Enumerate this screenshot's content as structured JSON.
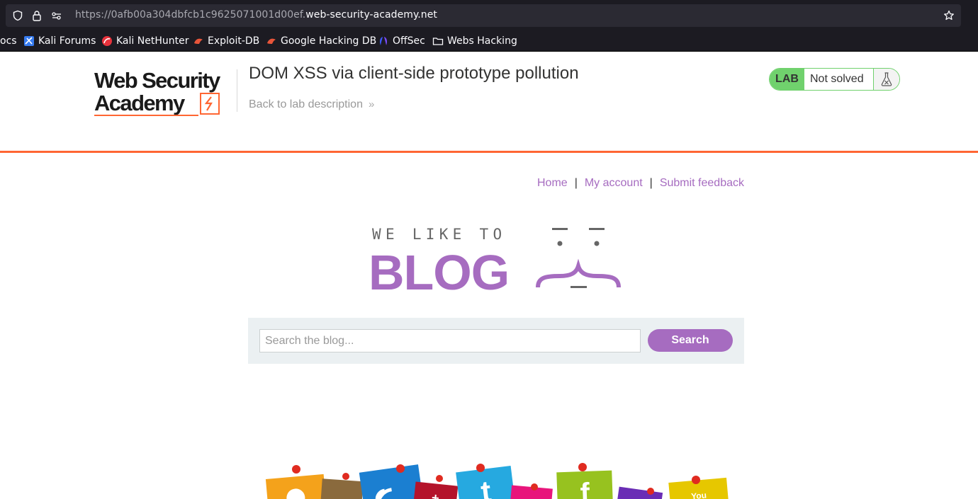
{
  "browser": {
    "url_prefix": "https://0afb00a304dbfcb1c9625071001d00ef.",
    "url_domain": "web-security-academy.net",
    "bookmarks": [
      {
        "label": "ocs",
        "icon": "docs-icon"
      },
      {
        "label": "Kali Forums",
        "icon": "kali-forums-icon"
      },
      {
        "label": "Kali NetHunter",
        "icon": "kali-nethunter-icon"
      },
      {
        "label": "Exploit-DB",
        "icon": "exploit-db-icon"
      },
      {
        "label": "Google Hacking DB",
        "icon": "ghdb-icon"
      },
      {
        "label": "OffSec",
        "icon": "offsec-icon"
      },
      {
        "label": "Webs Hacking",
        "icon": "folder-icon"
      }
    ]
  },
  "lab_header": {
    "logo_line1": "Web Security",
    "logo_line2": "Academy",
    "title": "DOM XSS via client-side prototype pollution",
    "back_link": "Back to lab description",
    "status_tag": "LAB",
    "status_text": "Not solved"
  },
  "nav": {
    "home": "Home",
    "separator": "|",
    "my_account": "My account",
    "feedback": "Submit feedback"
  },
  "banner": {
    "top_text": "WE LIKE TO",
    "main_text": "BLOG"
  },
  "search": {
    "placeholder": "Search the blog...",
    "button": "Search"
  },
  "colors": {
    "accent": "#a66cc0",
    "lab_orange": "#ff6633",
    "lab_green": "#70d16d",
    "search_bg": "#ebf0f2"
  }
}
